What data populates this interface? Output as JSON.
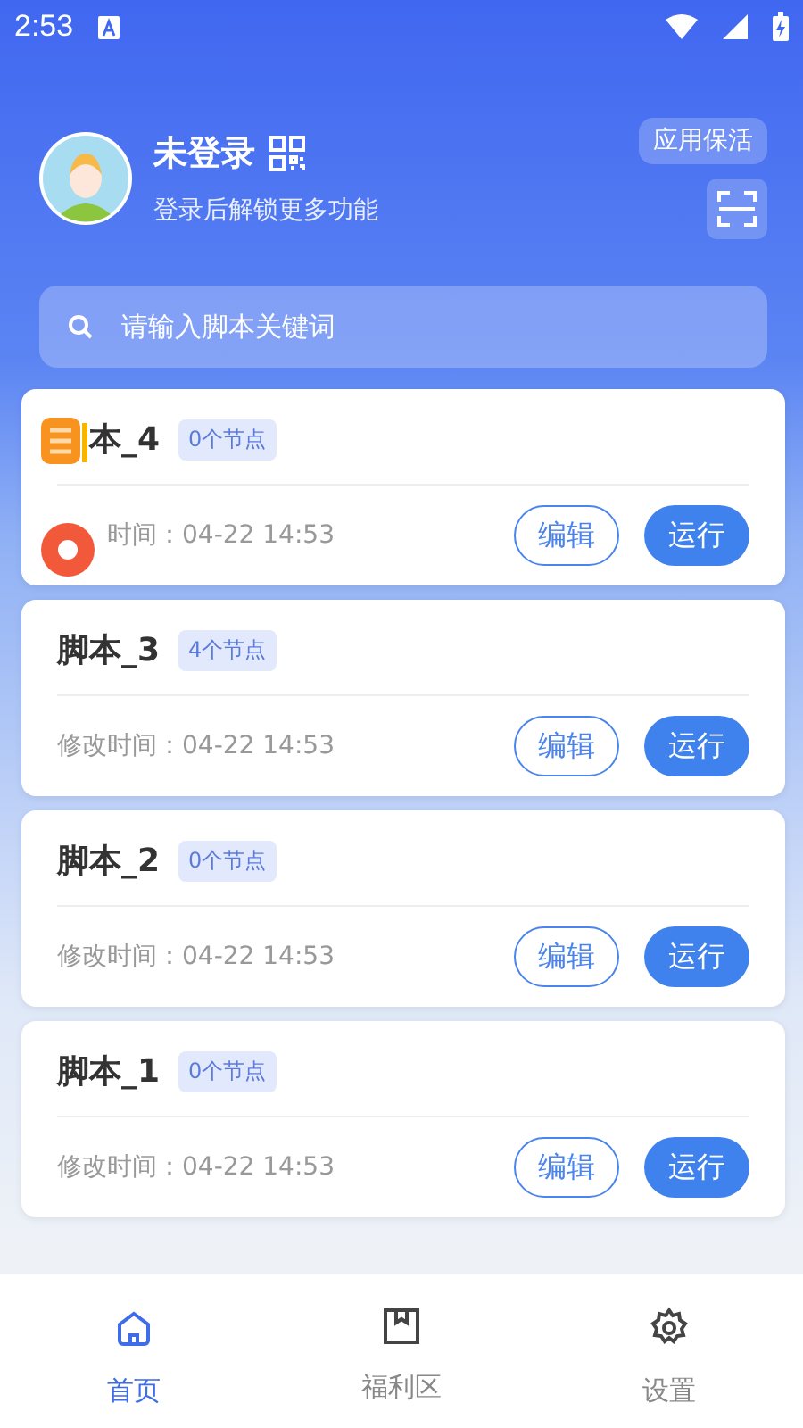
{
  "status_bar": {
    "time": "2:53"
  },
  "profile": {
    "name": "未登录",
    "subtitle": "登录后解锁更多功能",
    "keep_alive_button": "应用保活"
  },
  "search": {
    "placeholder": "请输入脚本关键词"
  },
  "scripts": [
    {
      "title": "本_4",
      "nodes": "0个节点",
      "modified": "时间：04-22 14:53",
      "edit": "编辑",
      "run": "运行"
    },
    {
      "title": "脚本_3",
      "nodes": "4个节点",
      "modified": "修改时间：04-22 14:53",
      "edit": "编辑",
      "run": "运行"
    },
    {
      "title": "脚本_2",
      "nodes": "0个节点",
      "modified": "修改时间：04-22 14:53",
      "edit": "编辑",
      "run": "运行"
    },
    {
      "title": "脚本_1",
      "nodes": "0个节点",
      "modified": "修改时间：04-22 14:53",
      "edit": "编辑",
      "run": "运行"
    }
  ],
  "tabs": [
    {
      "label": "首页",
      "kind": "home",
      "selected": true
    },
    {
      "label": "福利区",
      "kind": "bookmark",
      "selected": false
    },
    {
      "label": "设置",
      "kind": "settings",
      "selected": false
    }
  ]
}
